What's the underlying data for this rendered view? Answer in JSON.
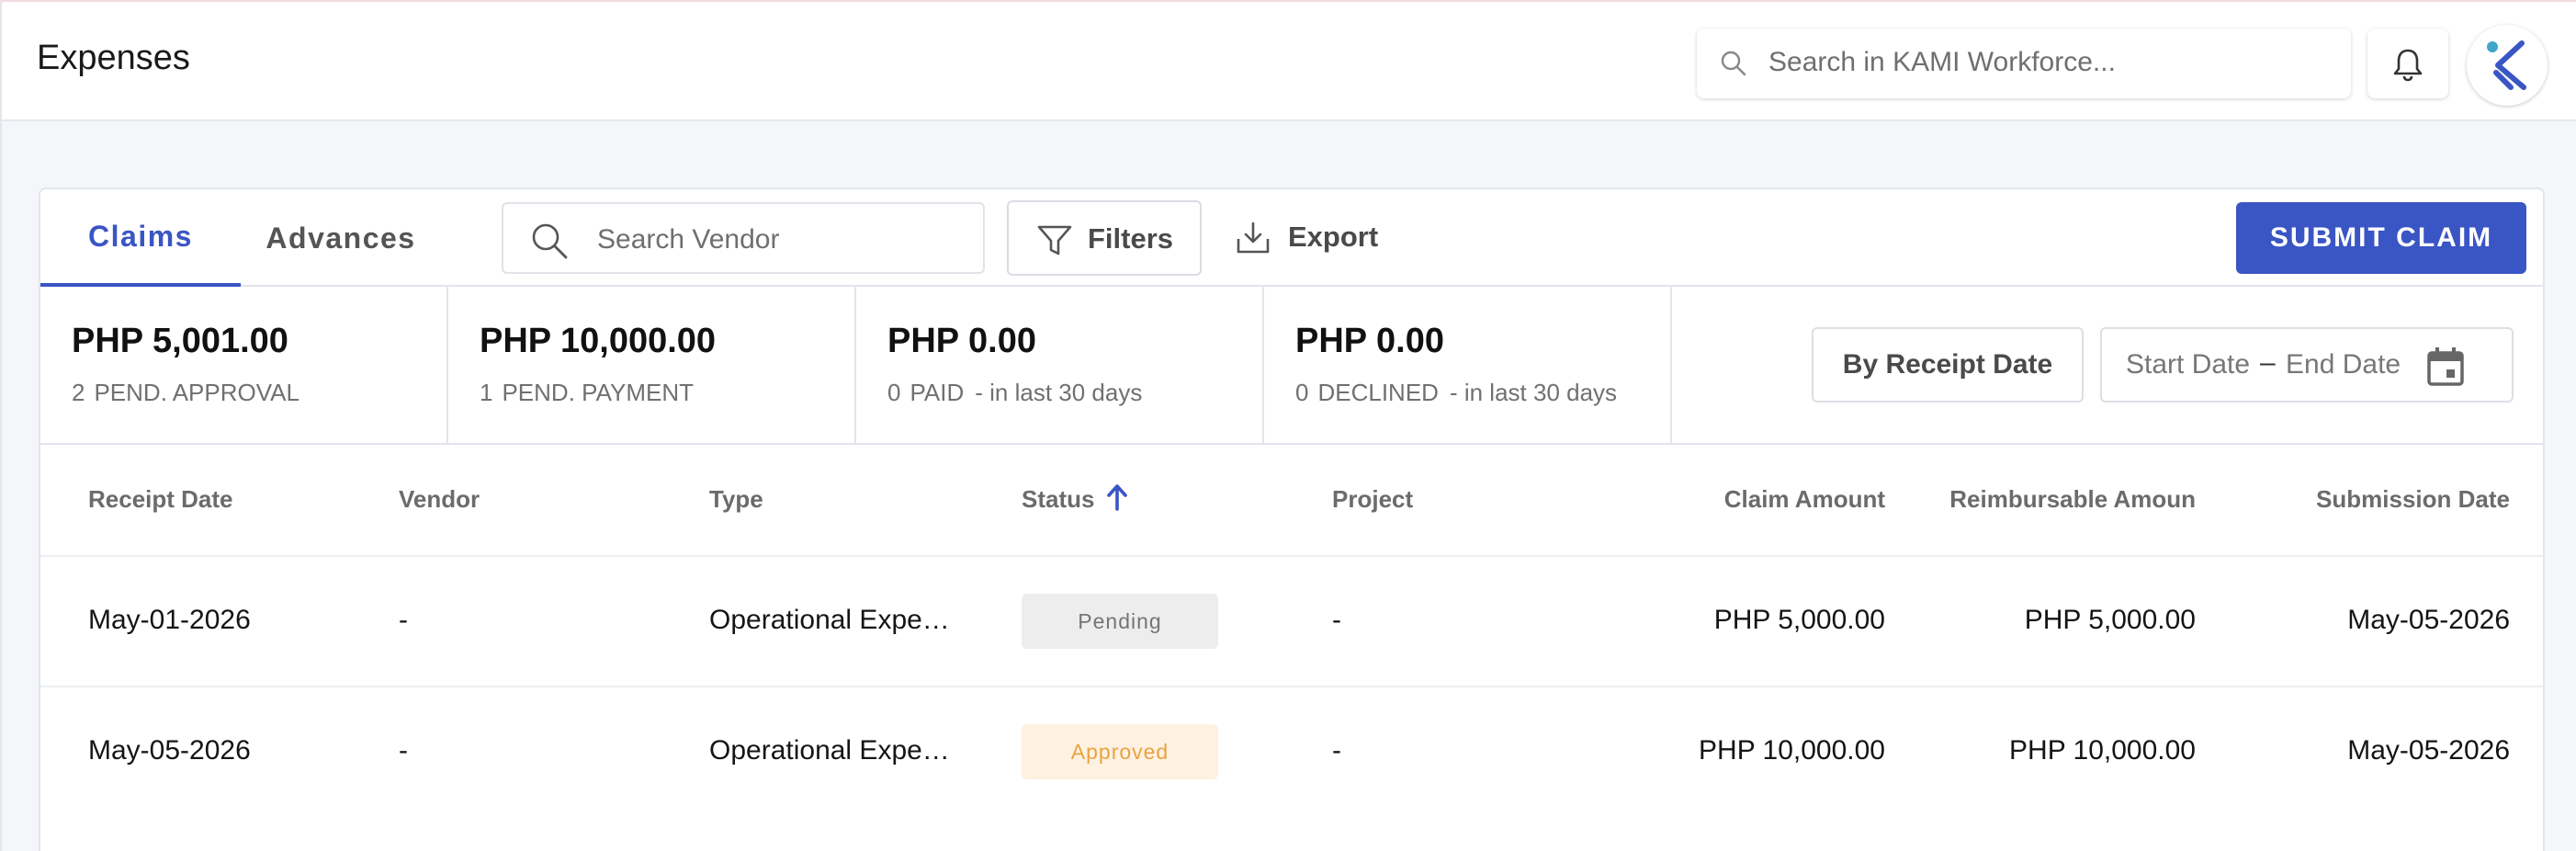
{
  "header": {
    "title": "Expenses",
    "search_placeholder": "Search in KAMI Workforce..."
  },
  "tabs": [
    {
      "label": "Claims",
      "active": true
    },
    {
      "label": "Advances",
      "active": false
    }
  ],
  "toolbar": {
    "vendor_search_placeholder": "Search Vendor",
    "filters_label": "Filters",
    "export_label": "Export",
    "submit_label": "SUBMIT CLAIM"
  },
  "summary": [
    {
      "amount": "PHP 5,001.00",
      "count": "2",
      "status": "PEND. APPROVAL",
      "period": ""
    },
    {
      "amount": "PHP 10,000.00",
      "count": "1",
      "status": "PEND. PAYMENT",
      "period": ""
    },
    {
      "amount": "PHP 0.00",
      "count": "0",
      "status": "PAID",
      "period": "- in last 30 days"
    },
    {
      "amount": "PHP 0.00",
      "count": "0",
      "status": "DECLINED",
      "period": "- in last 30 days"
    }
  ],
  "date_filter": {
    "mode_label": "By Receipt Date",
    "start_placeholder": "Start Date",
    "separator": "–",
    "end_placeholder": "End Date"
  },
  "table": {
    "columns": [
      "Receipt Date",
      "Vendor",
      "Type",
      "Status",
      "Project",
      "Claim Amount",
      "Reimbursable Amoun",
      "Submission Date"
    ],
    "sorted_column": "Status",
    "sort_direction": "ascending",
    "rows": [
      {
        "receipt_date": "May-01-2026",
        "vendor": "-",
        "type": "Operational Expe…",
        "status": "Pending",
        "project": "-",
        "claim_amount": "PHP 5,000.00",
        "reimbursable": "PHP 5,000.00",
        "submission_date": "May-05-2026"
      },
      {
        "receipt_date": "May-05-2026",
        "vendor": "-",
        "type": "Operational Expe…",
        "status": "Approved",
        "project": "-",
        "claim_amount": "PHP 10,000.00",
        "reimbursable": "PHP 10,000.00",
        "submission_date": "May-05-2026"
      }
    ]
  },
  "colors": {
    "accent": "#3a55c4",
    "pending_bg": "#ededee",
    "approved_bg": "#fff1e2",
    "approved_text": "#e8a33f"
  }
}
